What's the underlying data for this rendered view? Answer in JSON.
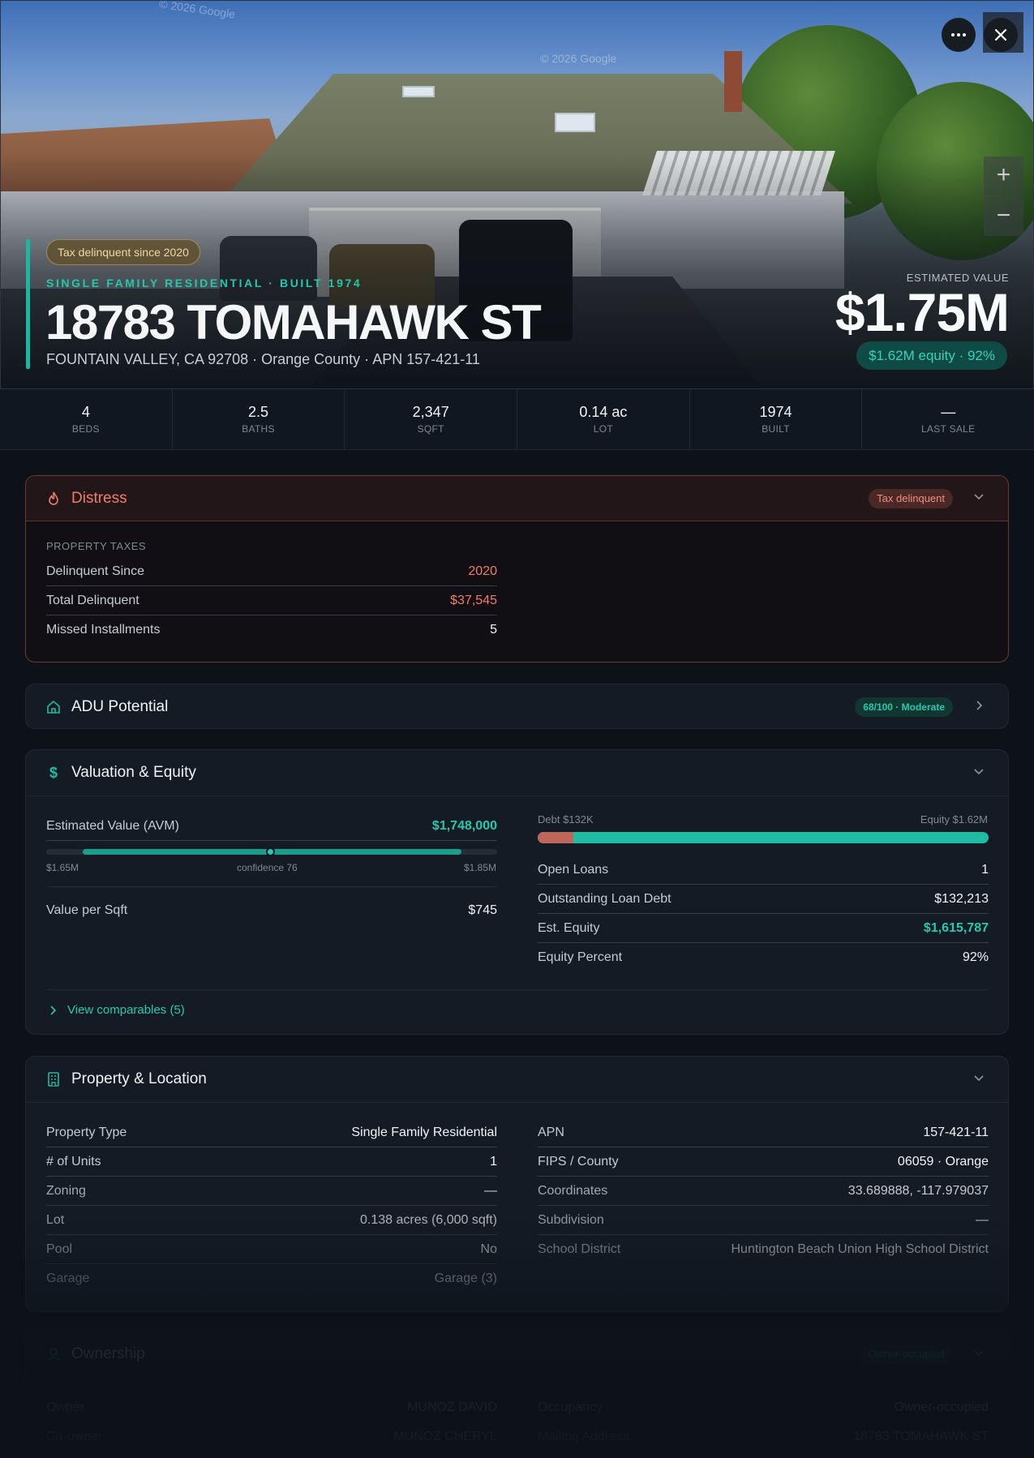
{
  "hero": {
    "watermarks": [
      "© 2026 Google",
      "© 2026 Google"
    ],
    "tax_badge": "Tax delinquent since 2020",
    "subtitle": "SINGLE FAMILY RESIDENTIAL · BUILT 1974",
    "title": "18783 TOMAHAWK ST",
    "address": "FOUNTAIN VALLEY, CA 92708 · Orange County · APN 157-421-11",
    "estimated_label": "ESTIMATED VALUE",
    "estimated_value": "$1.75M",
    "equity_pill": "$1.62M equity · 92%",
    "more_icon": "ellipsis-icon",
    "close_icon": "close-icon",
    "zoom_in": "+",
    "zoom_out": "−"
  },
  "stats": [
    {
      "value": "4",
      "label": "BEDS"
    },
    {
      "value": "2.5",
      "label": "BATHS"
    },
    {
      "value": "2,347",
      "label": "SQFT"
    },
    {
      "value": "0.14 ac",
      "label": "LOT"
    },
    {
      "value": "1974",
      "label": "BUILT"
    },
    {
      "value": "—",
      "label": "LAST SALE"
    }
  ],
  "distress": {
    "title": "Distress",
    "icon": "flame-icon",
    "pill": "Tax delinquent",
    "section_label": "PROPERTY TAXES",
    "rows": [
      {
        "k": "Delinquent Since",
        "v": "2020"
      },
      {
        "k": "Total Delinquent",
        "v": "$37,545"
      },
      {
        "k": "Missed Installments",
        "v": "5"
      }
    ]
  },
  "adu": {
    "title": "ADU Potential",
    "icon": "home-icon",
    "pill": "68/100 · Moderate"
  },
  "valuation": {
    "title": "Valuation & Equity",
    "icon": "dollar-icon",
    "avm_label": "Estimated Value (AVM)",
    "avm_value": "$1,748,000",
    "range_low": "$1.65M",
    "confidence": "confidence 76",
    "range_high": "$1.85M",
    "confidence_score": 76,
    "vps_label": "Value per Sqft",
    "vps_value": "$745",
    "debt_label": "Debt $132K",
    "equity_label": "Equity $1.62M",
    "equity_percent": 92,
    "right_rows": [
      {
        "k": "Open Loans",
        "v": "1"
      },
      {
        "k": "Outstanding Loan Debt",
        "v": "$132,213"
      },
      {
        "k": "Est. Equity",
        "v": "$1,615,787"
      },
      {
        "k": "Equity Percent",
        "v": "92%"
      }
    ],
    "comparables": "View comparables (5)"
  },
  "property": {
    "title": "Property & Location",
    "icon": "building-icon",
    "left_rows": [
      {
        "k": "Property Type",
        "v": "Single Family Residential"
      },
      {
        "k": "# of Units",
        "v": "1"
      },
      {
        "k": "Zoning",
        "v": "—"
      },
      {
        "k": "Lot",
        "v": "0.138 acres (6,000 sqft)"
      },
      {
        "k": "Pool",
        "v": "No"
      },
      {
        "k": "Garage",
        "v": "Garage (3)"
      }
    ],
    "right_rows": [
      {
        "k": "APN",
        "v": "157-421-11"
      },
      {
        "k": "FIPS / County",
        "v": "06059 · Orange"
      },
      {
        "k": "Coordinates",
        "v": "33.689888, -117.979037"
      },
      {
        "k": "Subdivision",
        "v": "—"
      },
      {
        "k": "School District",
        "v": "Huntington Beach Union High School District"
      }
    ]
  },
  "ownership": {
    "title": "Ownership",
    "icon": "person-icon",
    "pill": "Owner-occupied",
    "left_rows": [
      {
        "k": "Owner",
        "v": "MUNOZ DAVID"
      },
      {
        "k": "Co-owner",
        "v": "MUNOZ CHERYL"
      }
    ],
    "right_rows": [
      {
        "k": "Occupancy",
        "v": "Owner-occupied"
      },
      {
        "k": "Mailing Address",
        "v": "18783 TOMAHAWK ST"
      }
    ]
  },
  "colors": {
    "accent": "#1fbca3",
    "distress": "#f07d6a",
    "debt": "#c0655a"
  }
}
